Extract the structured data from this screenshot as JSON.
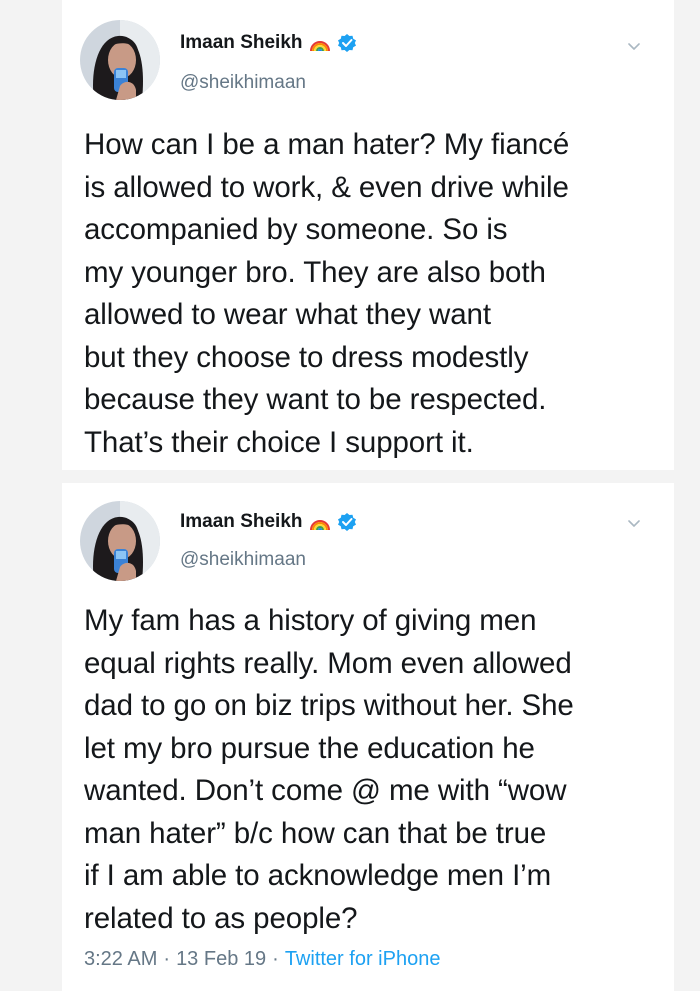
{
  "tweets": [
    {
      "author": {
        "name": "Imaan Sheikh",
        "handle": "@sheikhimaan",
        "verified": true,
        "emoji": "rainbow-icon"
      },
      "text": "How can I be a man hater? My fiancé\nis allowed to work, & even drive while\naccompanied by someone. So is\nmy younger bro. They are also both\nallowed to wear what they want\nbut they choose to dress modestly\nbecause they want to be respected.\nThat’s their choice I support it."
    },
    {
      "author": {
        "name": "Imaan Sheikh",
        "handle": "@sheikhimaan",
        "verified": true,
        "emoji": "rainbow-icon"
      },
      "text": "My fam has a history of giving men\nequal rights really. Mom even allowed\ndad to go on biz trips without her. She\nlet my bro pursue the education he\nwanted. Don’t come @ me with “wow\nman hater” b/c how can that be true\nif I am able to acknowledge men I’m\nrelated to as people?",
      "time": "3:22 AM",
      "date": "13 Feb 19",
      "separator": "·",
      "source": "Twitter for iPhone"
    }
  ],
  "colors": {
    "background": "#f3f3f3",
    "card": "#ffffff",
    "text": "#14171a",
    "secondary": "#657786",
    "link": "#1da1f2",
    "verified": "#1da1f2"
  }
}
